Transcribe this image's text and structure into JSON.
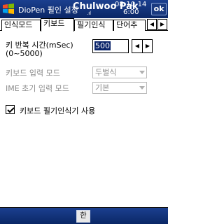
{
  "titlebar": {
    "app_title": "DioPen 필인 설정",
    "overlay_name": "Chulwoo Pak",
    "signal": ".ıl",
    "date": "08-10-14",
    "time": "6:00",
    "ok_label": "ok"
  },
  "tabs": [
    {
      "label": "인식모드",
      "active": false
    },
    {
      "label": "키보드",
      "active": true
    },
    {
      "label": "필기인식",
      "active": false
    },
    {
      "label": "단어추",
      "active": false
    }
  ],
  "tab_scroll": {
    "left": "◀",
    "right": "▶"
  },
  "repeat": {
    "label_line1": "키 반복 시간(mSec)",
    "label_line2": "(0~5000)",
    "value": "500",
    "spin_left": "◀",
    "spin_right": "▶"
  },
  "keyboard_mode": {
    "label": "키보드 입력 모드",
    "value": "두벌식",
    "disabled": true
  },
  "ime_mode": {
    "label": "IME 초기 입력 모드",
    "value": "기본",
    "disabled": true
  },
  "use_recognizer": {
    "label": "키보드 필기인식기 사용",
    "checked": true
  },
  "bottombar": {
    "ime_label": "한"
  }
}
